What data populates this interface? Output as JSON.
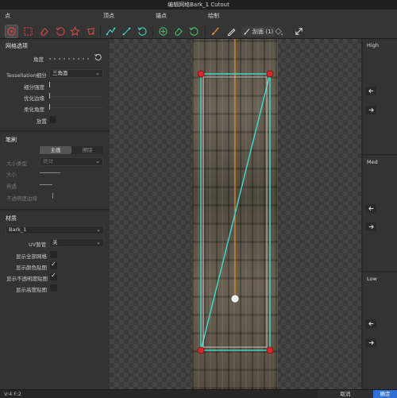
{
  "window": {
    "title": "编辑网格Bark_1 Cutout"
  },
  "toolbar": {
    "groups": {
      "point": "点",
      "vertex": "顶点",
      "anchor": "锚点",
      "paint": "绘制"
    },
    "brush_label": "刮面 (1)"
  },
  "left": {
    "grid_section": {
      "title": "网格选项",
      "angle_label": "角度",
      "tess_label": "Tessellation细分",
      "tess_value": "三角面",
      "subdiv_label": "细分强度",
      "edge_label": "优化边缘",
      "corner_label": "柔化角度",
      "flip_label": "放置"
    },
    "brush_section": {
      "title": "笔刷",
      "mode_main": "主画",
      "mode_erase": "擦除",
      "size_type_label": "大小类型",
      "size_type_value": "绝对",
      "size_label": "大小",
      "hardness_label": "界遇",
      "opacity_label": "不透明度边缘"
    },
    "material_section": {
      "title": "材质",
      "material_value": "Bark_1",
      "uv_label": "UV暂管",
      "uv_value": "关",
      "show_grid_label": "显示全部网格",
      "show_color_label": "显示颜色贴图",
      "show_opacity_label": "显示不透明度贴图",
      "show_height_label": "显示高度贴图",
      "show_grid": false,
      "show_color": true,
      "show_opacity": true,
      "show_height": false
    }
  },
  "right": {
    "sections": [
      {
        "title": "High"
      },
      {
        "title": "Med"
      },
      {
        "title": "Low"
      }
    ]
  },
  "status": {
    "text": "V:4  F:2",
    "cancel": "取消",
    "ok": "确定"
  },
  "colors": {
    "accent": "#2f6fd6",
    "mesh": "#3fd6c8",
    "pivot_line": "#f29a1e",
    "vertex": "#d42a2a",
    "icon_red": "#d94545",
    "icon_green": "#3fbf6a",
    "icon_cyan": "#3fd6c8",
    "icon_orange": "#e88a2a"
  }
}
